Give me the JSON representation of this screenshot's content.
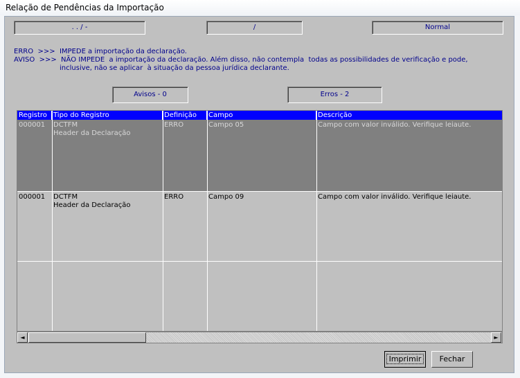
{
  "window": {
    "title": "Relação de Pendências da Importação"
  },
  "fields": {
    "cnpj": ". . /  -",
    "periodo": "/",
    "tipo": "Normal"
  },
  "legend": {
    "erro": "ERRO  >>>  IMPEDE a importação da declaração.",
    "aviso1": "AVISO  >>>  NÃO IMPEDE  a importação da declaração. Além disso, não contempla  todas as possibilidades de verificação e pode,",
    "aviso2": "inclusive, não se aplicar  à situação da pessoa jurídica declarante."
  },
  "counters": {
    "avisos": "Avisos - 0",
    "erros": "Erros - 2"
  },
  "table": {
    "headers": [
      "Registro",
      "Tipo do Registro",
      "Definição",
      "Campo",
      "Descrição"
    ],
    "rows": [
      {
        "registro": "000001",
        "tipo1": "DCTFM",
        "tipo2": "Header da Declaração",
        "definicao": "ERRO",
        "campo": "Campo 05",
        "descricao": "Campo com valor inválido. Verifique leiaute."
      },
      {
        "registro": "000001",
        "tipo1": "DCTFM",
        "tipo2": "Header da Declaração",
        "definicao": "ERRO",
        "campo": "Campo 09",
        "descricao": "Campo com valor inválido. Verifique leiaute."
      }
    ]
  },
  "buttons": {
    "imprimir": "Imprimir",
    "fechar": "Fechar"
  },
  "icons": {
    "left": "◄",
    "right": "►"
  }
}
